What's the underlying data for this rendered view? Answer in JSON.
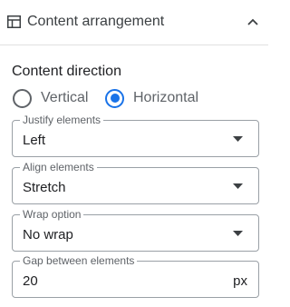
{
  "header": {
    "title": "Content arrangement",
    "icon": "layout-icon",
    "collapse_icon": "chevron-up-icon"
  },
  "content_direction": {
    "label": "Content direction",
    "options": [
      {
        "label": "Vertical",
        "checked": false
      },
      {
        "label": "Horizontal",
        "checked": true
      }
    ]
  },
  "fields": {
    "justify": {
      "label": "Justify elements",
      "value": "Left"
    },
    "align": {
      "label": "Align elements",
      "value": "Stretch"
    },
    "wrap": {
      "label": "Wrap option",
      "value": "No wrap"
    },
    "gap": {
      "label": "Gap between elements",
      "value": "20",
      "unit": "px"
    }
  },
  "colors": {
    "accent": "#1a73e8",
    "border": "#9aa0a6",
    "text": "#202124",
    "muted": "#5f6368"
  }
}
